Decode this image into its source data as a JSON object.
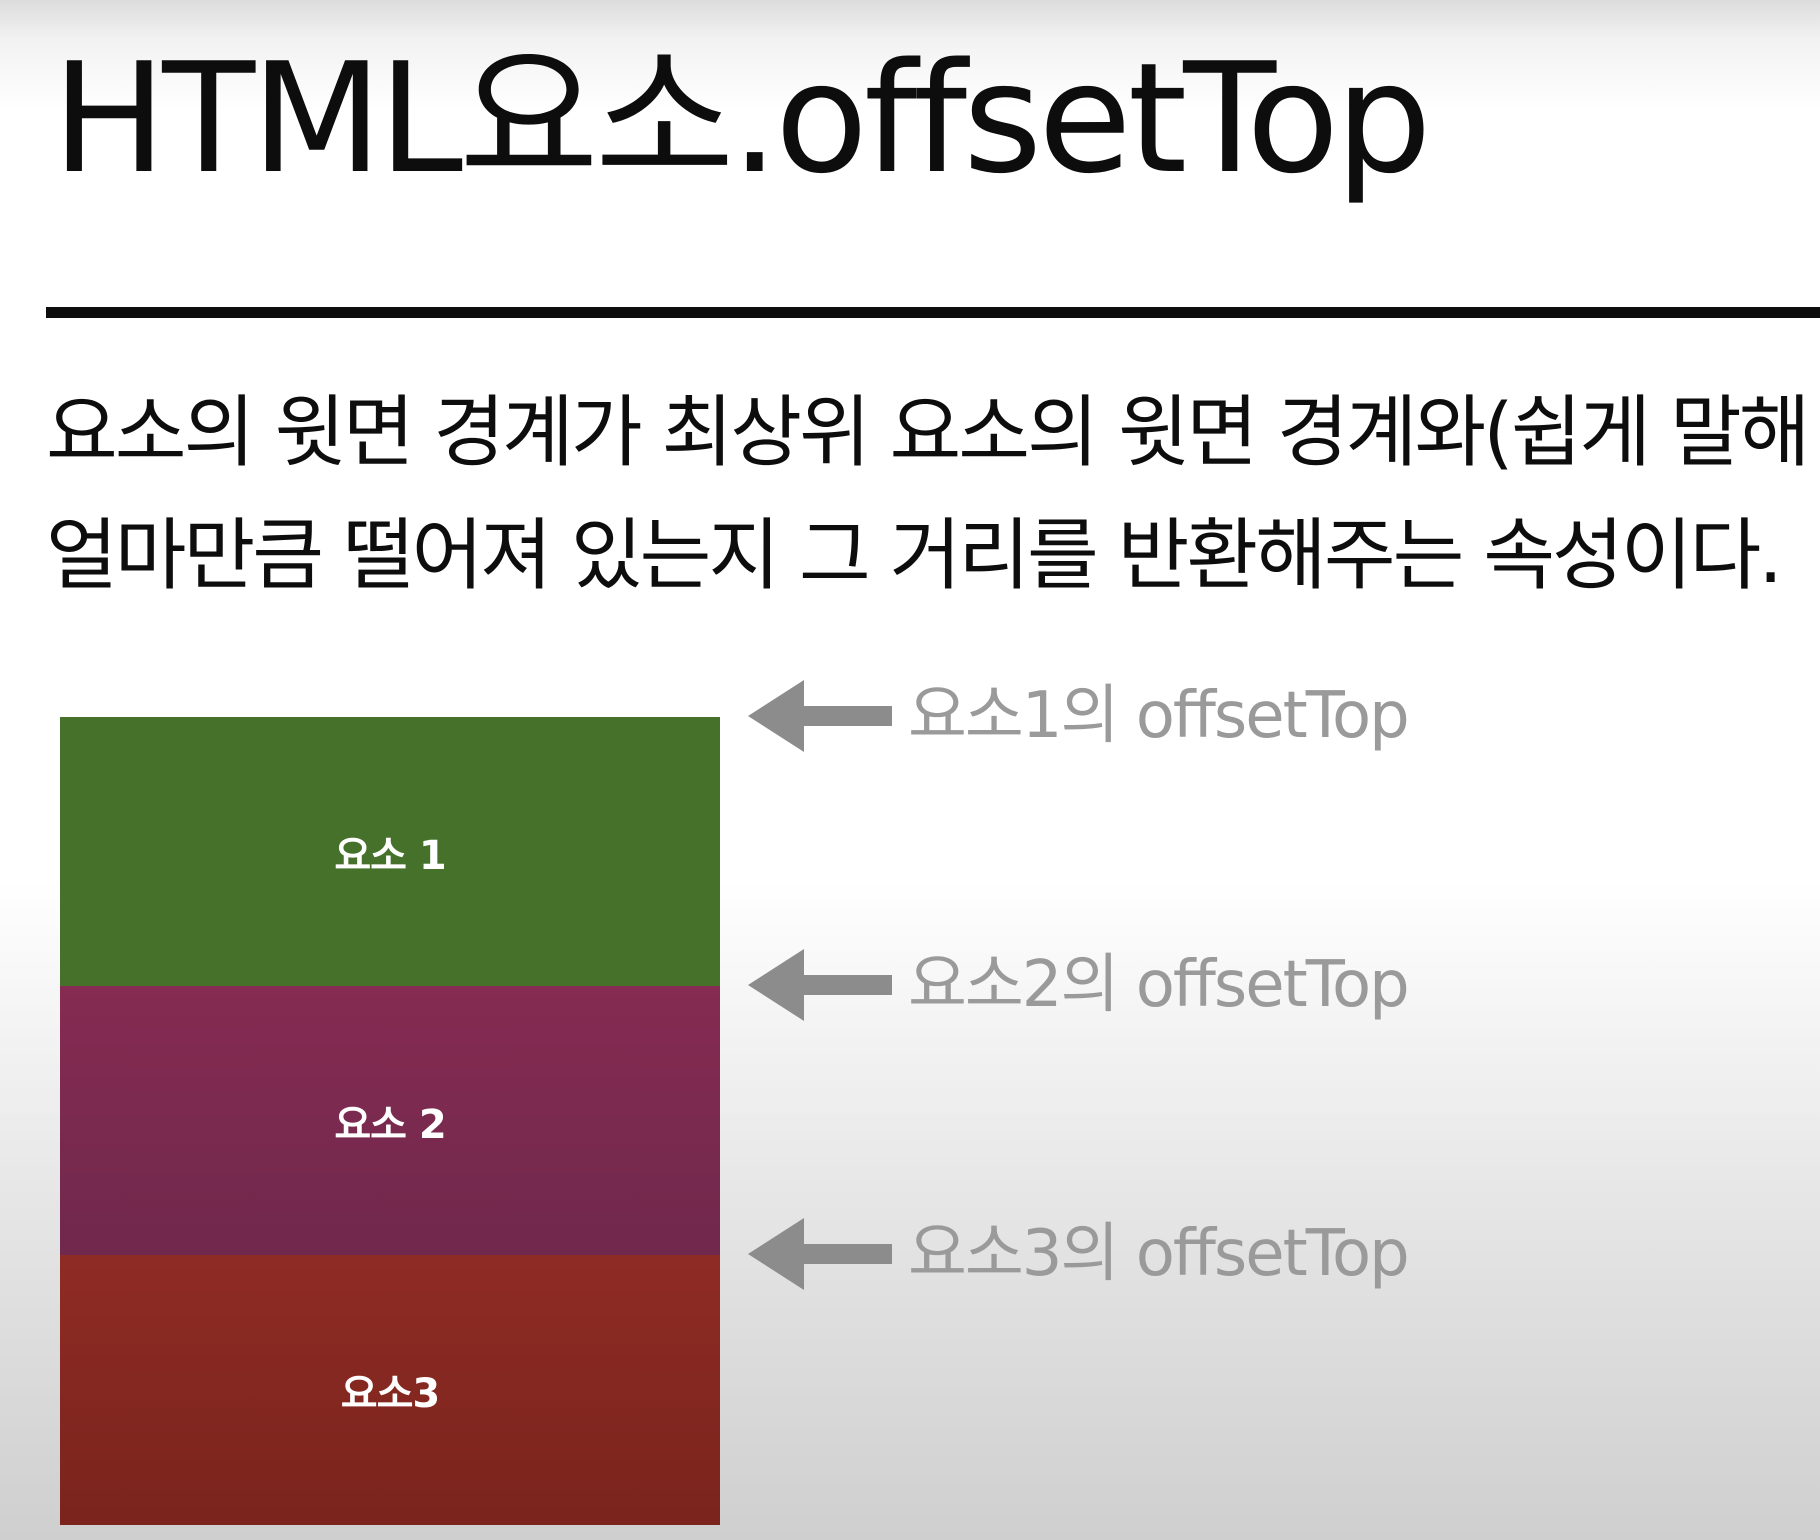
{
  "title": "HTML요소.offsetTop",
  "description": {
    "line1": "요소의 윗면 경계가 최상위 요소의 윗면 경계와(쉽게 말해",
    "line2": "얼마만큼 떨어져 있는지 그 거리를 반환해주는 속성이다."
  },
  "boxes": [
    {
      "label": "요소 1",
      "color": "#46712b"
    },
    {
      "label": "요소 2",
      "color": "#7d2a50"
    },
    {
      "label": "요소3",
      "color": "#852820"
    }
  ],
  "markers": [
    {
      "label": "요소1의 offsetTop",
      "icon": "left-arrow-icon"
    },
    {
      "label": "요소2의 offsetTop",
      "icon": "left-arrow-icon"
    },
    {
      "label": "요소3의 offsetTop",
      "icon": "left-arrow-icon"
    }
  ],
  "colors": {
    "text": "#0d0d0d",
    "marker": "#8c8c8c"
  }
}
